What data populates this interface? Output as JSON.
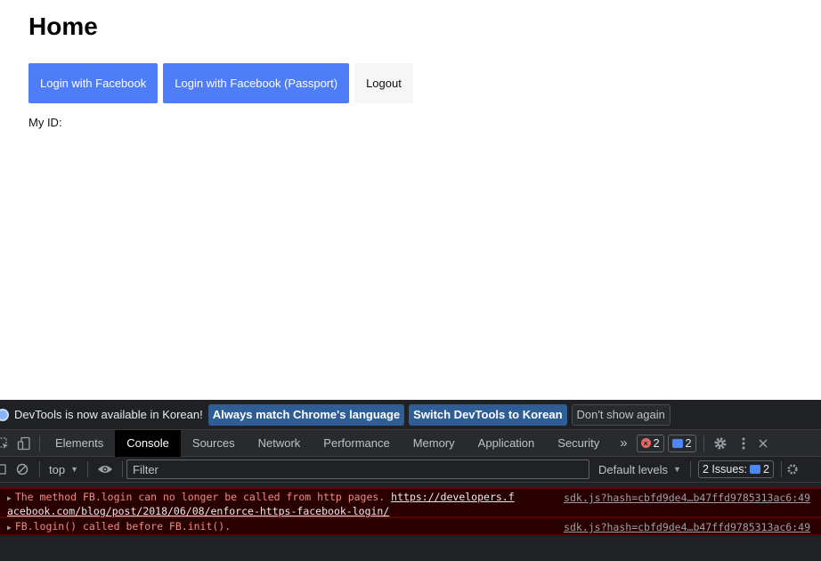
{
  "page": {
    "title": "Home",
    "buttons": {
      "login_facebook": "Login with Facebook",
      "login_facebook_passport": "Login with Facebook (Passport)",
      "logout": "Logout"
    },
    "my_id_label": "My ID:"
  },
  "devtools": {
    "infobar": {
      "text": "DevTools is now available in Korean!",
      "match_language": "Always match Chrome's language",
      "switch_korean": "Switch DevTools to Korean",
      "dont_show": "Don't show again"
    },
    "tabs": [
      "Elements",
      "Console",
      "Sources",
      "Network",
      "Performance",
      "Memory",
      "Application",
      "Security"
    ],
    "active_tab": "Console",
    "more_tabs": "»",
    "error_count": "2",
    "message_count": "2",
    "context": "top",
    "filter_placeholder": "Filter",
    "levels": "Default levels",
    "issues_label": "2 Issues:",
    "issues_count": "2",
    "messages": [
      {
        "text": "The method FB.login can no longer be called from http pages. ",
        "link_part1": "https://developers.f",
        "link_part2": "acebook.com/blog/post/2018/06/08/enforce-https-facebook-login/",
        "source": "sdk.js?hash=cbfd9de4…b47ffd9785313ac6:49"
      },
      {
        "text": "FB.login() called before FB.init().",
        "source": "sdk.js?hash=cbfd9de4…b47ffd9785313ac6:49"
      }
    ]
  },
  "colors": {
    "primary_button": "#4f7cf7",
    "devtools_bg": "#202124",
    "error_text": "#f28b82",
    "error_row_bg": "#290000"
  }
}
